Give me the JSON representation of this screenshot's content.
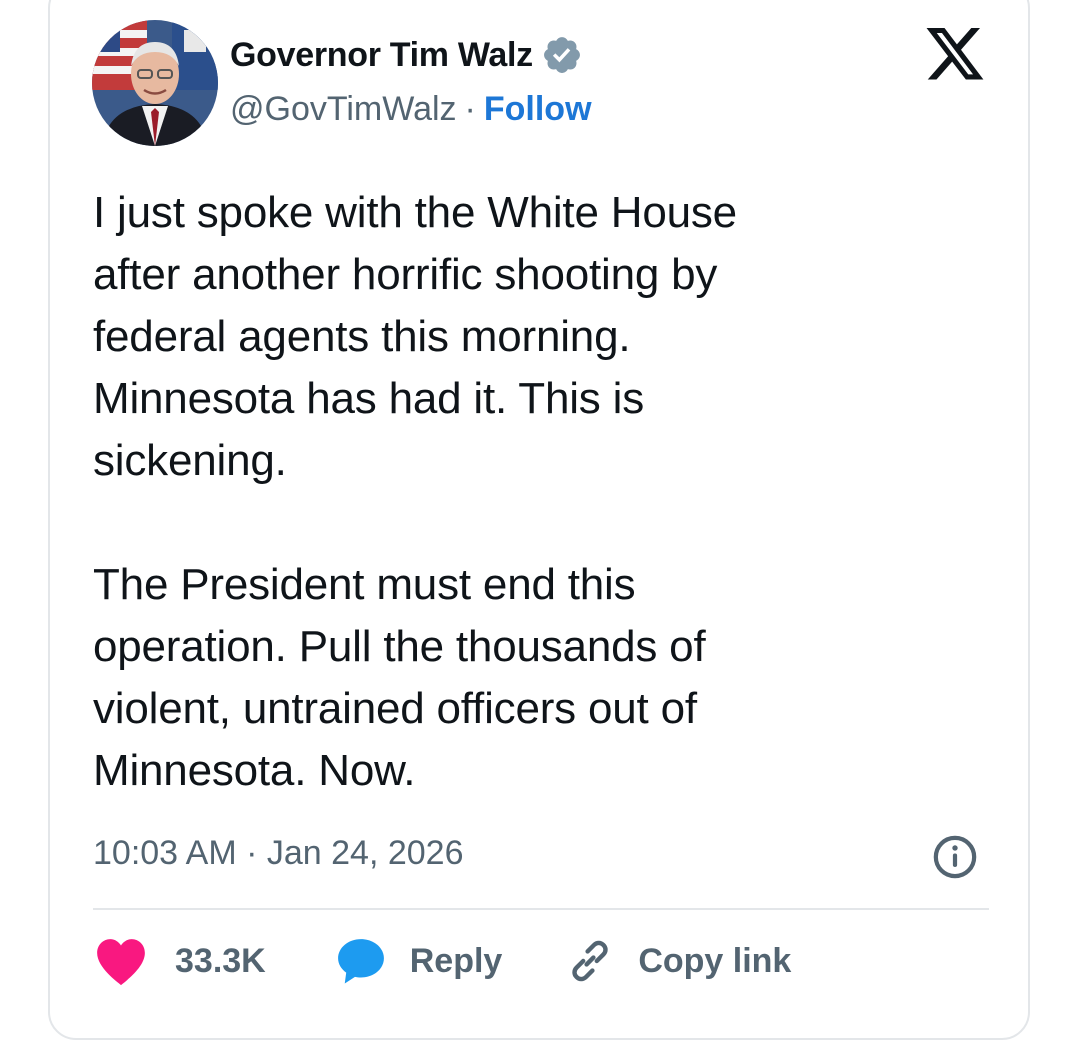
{
  "author": {
    "display_name": "Governor Tim Walz",
    "handle": "@GovTimWalz",
    "separator": "·",
    "follow_label": "Follow",
    "verified": true
  },
  "tweet": {
    "text": "I just spoke with the White House\nafter another horrific shooting by\nfederal agents this morning.\nMinnesota has had it. This is\nsickening.\n\nThe President must end this\noperation. Pull the thousands of\nviolent, untrained officers out of\nMinnesota. Now.",
    "timestamp": "10:03 AM · Jan 24, 2026"
  },
  "actions": {
    "like_count": "33.3K",
    "reply_label": "Reply",
    "copy_link_label": "Copy link"
  },
  "icons": {
    "logo": "x-logo-icon",
    "verified": "verified-badge-icon",
    "info": "info-icon",
    "like": "heart-icon",
    "reply": "speech-bubble-icon",
    "copy": "link-icon"
  },
  "colors": {
    "follow": "#1d77d6",
    "heart": "#f91880",
    "reply": "#1d9bf0",
    "verified": "#829aab",
    "secondary_text": "#536471"
  }
}
